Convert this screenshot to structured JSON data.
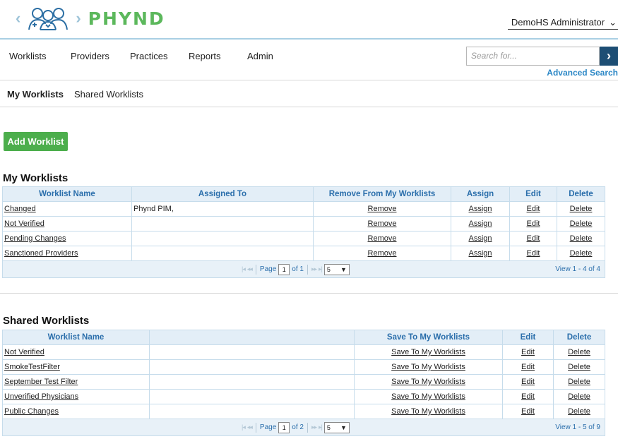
{
  "header": {
    "brand": "PHYND",
    "user": "DemoHS Administrator"
  },
  "nav": {
    "items": [
      "Worklists",
      "Providers",
      "Practices",
      "Reports",
      "Admin"
    ],
    "search_placeholder": "Search for...",
    "advanced_search": "Advanced Search"
  },
  "subnav": {
    "tabs": [
      "My Worklists",
      "Shared Worklists"
    ]
  },
  "add_worklist": "Add Worklist",
  "my_worklists": {
    "title": "My Worklists",
    "columns": [
      "Worklist Name",
      "Assigned To",
      "Remove From My Worklists",
      "Assign",
      "Edit",
      "Delete"
    ],
    "rows": [
      {
        "name": "Changed",
        "assigned": "Phynd PIM,",
        "remove": "Remove",
        "assign": "Assign",
        "edit": "Edit",
        "delete": "Delete"
      },
      {
        "name": "Not Verified",
        "assigned": "",
        "remove": "Remove",
        "assign": "Assign",
        "edit": "Edit",
        "delete": "Delete"
      },
      {
        "name": "Pending Changes",
        "assigned": "",
        "remove": "Remove",
        "assign": "Assign",
        "edit": "Edit",
        "delete": "Delete"
      },
      {
        "name": "Sanctioned Providers",
        "assigned": "",
        "remove": "Remove",
        "assign": "Assign",
        "edit": "Edit",
        "delete": "Delete"
      }
    ],
    "pager": {
      "page_label": "Page",
      "page": "1",
      "of": "of 1",
      "page_size": "5",
      "view": "View 1 - 4 of 4"
    }
  },
  "shared_worklists": {
    "title": "Shared Worklists",
    "columns": [
      "Worklist Name",
      "",
      "Save To My Worklists",
      "Edit",
      "Delete"
    ],
    "rows": [
      {
        "name": "Not Verified",
        "save": "Save To My Worklists",
        "edit": "Edit",
        "delete": "Delete"
      },
      {
        "name": "SmokeTestFilter",
        "save": "Save To My Worklists",
        "edit": "Edit",
        "delete": "Delete"
      },
      {
        "name": "September Test Filter",
        "save": "Save To My Worklists",
        "edit": "Edit",
        "delete": "Delete"
      },
      {
        "name": "Unverified Physicians",
        "save": "Save To My Worklists",
        "edit": "Edit",
        "delete": "Delete"
      },
      {
        "name": "Public Changes",
        "save": "Save To My Worklists",
        "edit": "Edit",
        "delete": "Delete"
      }
    ],
    "pager": {
      "page_label": "Page",
      "page": "1",
      "of": "of 2",
      "page_size": "5",
      "view": "View 1 - 5 of 9"
    }
  },
  "icons": {
    "back": "chevron-left-icon",
    "forward": "chevron-right-icon",
    "logo": "doctors-group-icon",
    "user_caret": "chevron-down-icon",
    "search_go": "chevron-right-icon",
    "pager_first": "first-page-icon",
    "pager_prev": "prev-page-icon",
    "pager_next": "next-page-icon",
    "pager_last": "last-page-icon"
  },
  "colors": {
    "brand_green": "#5cb85c",
    "add_button": "#4cae4c",
    "link_blue": "#2b87c6",
    "header_blue": "#2a6eab",
    "search_button": "#1d4e74",
    "grid_header_bg": "#e3eef7"
  }
}
